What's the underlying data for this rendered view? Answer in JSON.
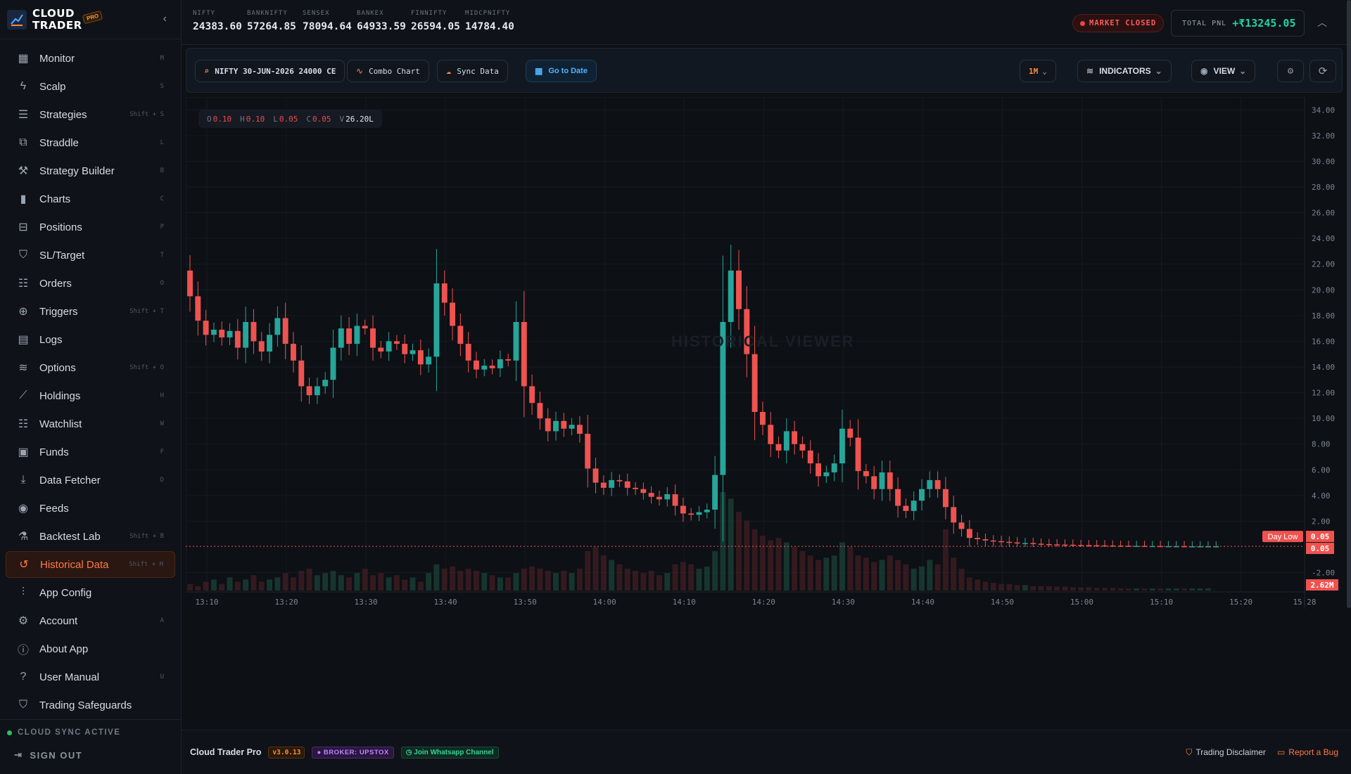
{
  "brand": {
    "name_line1": "CLOUD",
    "name_line2": "TRADER",
    "badge": "PRO"
  },
  "sidebar": {
    "items": [
      {
        "label": "Monitor",
        "shortcut": "M",
        "icon": "grid-icon"
      },
      {
        "label": "Scalp",
        "shortcut": "S",
        "icon": "bolt-icon"
      },
      {
        "label": "Strategies",
        "shortcut": "Shift + S",
        "icon": "layers-icon"
      },
      {
        "label": "Straddle",
        "shortcut": "L",
        "icon": "straddle-icon"
      },
      {
        "label": "Strategy Builder",
        "shortcut": "B",
        "icon": "wrench-icon"
      },
      {
        "label": "Charts",
        "shortcut": "C",
        "icon": "bar-chart-icon"
      },
      {
        "label": "Positions",
        "shortcut": "P",
        "icon": "briefcase-icon"
      },
      {
        "label": "SL/Target",
        "shortcut": "T",
        "icon": "shield-icon"
      },
      {
        "label": "Orders",
        "shortcut": "O",
        "icon": "list-icon"
      },
      {
        "label": "Triggers",
        "shortcut": "Shift + T",
        "icon": "target-icon"
      },
      {
        "label": "Logs",
        "shortcut": "",
        "icon": "document-icon"
      },
      {
        "label": "Options",
        "shortcut": "Shift + O",
        "icon": "stack-icon"
      },
      {
        "label": "Holdings",
        "shortcut": "H",
        "icon": "line-chart-icon"
      },
      {
        "label": "Watchlist",
        "shortcut": "W",
        "icon": "list-icon"
      },
      {
        "label": "Funds",
        "shortcut": "F",
        "icon": "wallet-icon"
      },
      {
        "label": "Data Fetcher",
        "shortcut": "D",
        "icon": "download-icon"
      },
      {
        "label": "Feeds",
        "shortcut": "",
        "icon": "broadcast-icon"
      },
      {
        "label": "Backtest Lab",
        "shortcut": "Shift + B",
        "icon": "flask-icon"
      },
      {
        "label": "Historical Data",
        "shortcut": "Shift + H",
        "icon": "history-icon",
        "active": true
      },
      {
        "label": "App Config",
        "shortcut": "",
        "icon": "sliders-icon"
      },
      {
        "label": "Account",
        "shortcut": "A",
        "icon": "gear-icon"
      },
      {
        "label": "About App",
        "shortcut": "",
        "icon": "info-icon"
      },
      {
        "label": "User Manual",
        "shortcut": "U",
        "icon": "help-icon"
      },
      {
        "label": "Trading Safeguards",
        "shortcut": "",
        "icon": "shield-icon"
      }
    ],
    "sync_status": "CLOUD SYNC ACTIVE",
    "sign_out": "SIGN OUT"
  },
  "ticker": [
    {
      "name": "NIFTY",
      "value": "24383.60"
    },
    {
      "name": "BANKNIFTY",
      "value": "57264.85"
    },
    {
      "name": "SENSEX",
      "value": "78094.64"
    },
    {
      "name": "BANKEX",
      "value": "64933.59"
    },
    {
      "name": "FINNIFTY",
      "value": "26594.05"
    },
    {
      "name": "MIDCPNIFTY",
      "value": "14784.40"
    }
  ],
  "market_status": "MARKET CLOSED",
  "pnl": {
    "label": "TOTAL PNL",
    "value": "+₹13245.05"
  },
  "toolbar": {
    "symbol": "NIFTY 30-JUN-2026 24000 CE",
    "combo": "Combo Chart",
    "sync": "Sync Data",
    "goto": "Go to Date",
    "timeframe": "1M",
    "indicators": "INDICATORS",
    "view": "VIEW"
  },
  "ohlc": {
    "o": "0.10",
    "h": "0.10",
    "l": "0.05",
    "c": "0.05",
    "v": "26.20L"
  },
  "watermark": "HISTORICAL VIEWER",
  "chart_data": {
    "type": "candlestick",
    "interval": "1M",
    "x_ticks": [
      "13:10",
      "13:20",
      "13:30",
      "13:40",
      "13:50",
      "14:00",
      "14:10",
      "14:20",
      "14:30",
      "14:40",
      "14:50",
      "15:00",
      "15:10",
      "15:20",
      "15:28"
    ],
    "y_ticks": [
      "34.00",
      "32.00",
      "30.00",
      "28.00",
      "26.00",
      "24.00",
      "22.00",
      "20.00",
      "18.00",
      "16.00",
      "14.00",
      "12.00",
      "10.00",
      "8.00",
      "6.00",
      "4.00",
      "2.00",
      "-2.00"
    ],
    "ylim": [
      -3.5,
      35
    ],
    "close_series": [
      19.5,
      17.6,
      16.5,
      16.9,
      16.3,
      16.8,
      15.5,
      17.5,
      16.0,
      15.2,
      16.5,
      17.8,
      15.8,
      14.5,
      12.5,
      11.8,
      12.5,
      13.0,
      15.5,
      17.0,
      15.8,
      17.2,
      17.0,
      15.5,
      15.2,
      16.0,
      15.8,
      15.0,
      15.3,
      14.2,
      14.8,
      20.5,
      19.0,
      17.2,
      15.8,
      14.5,
      13.8,
      14.1,
      13.9,
      14.6,
      14.5,
      17.5,
      12.5,
      11.2,
      10.0,
      9.0,
      9.8,
      9.2,
      9.5,
      8.8,
      6.1,
      5.0,
      4.6,
      5.2,
      5.1,
      4.6,
      4.5,
      4.2,
      3.9,
      3.7,
      4.1,
      3.2,
      2.6,
      2.5,
      2.7,
      2.9,
      5.6,
      17.5,
      21.5,
      18.5,
      15.0,
      10.5,
      9.5,
      8.0,
      7.5,
      9.0,
      8.0,
      7.5,
      6.5,
      5.5,
      5.8,
      6.5,
      9.2,
      8.5,
      5.9,
      5.5,
      4.5,
      5.8,
      4.5,
      3.2,
      2.8,
      3.6,
      4.5,
      5.2,
      4.5,
      3.1,
      1.9,
      1.4,
      0.7,
      0.6,
      0.5,
      0.45,
      0.4,
      0.35,
      0.3,
      0.3,
      0.25,
      0.22,
      0.2,
      0.18,
      0.17,
      0.15,
      0.14,
      0.13,
      0.12,
      0.11,
      0.1,
      0.09,
      0.08,
      0.08,
      0.07,
      0.07,
      0.06,
      0.06,
      0.06,
      0.05,
      0.05,
      0.05,
      0.05,
      0.05
    ],
    "volume_series": [
      0.3,
      0.2,
      0.4,
      0.5,
      0.3,
      0.6,
      0.4,
      0.5,
      0.7,
      0.4,
      0.5,
      0.6,
      0.8,
      0.6,
      0.9,
      1.0,
      0.7,
      0.8,
      0.9,
      0.7,
      0.6,
      0.8,
      1.0,
      0.7,
      0.8,
      0.6,
      0.7,
      0.5,
      0.6,
      0.4,
      0.8,
      1.2,
      1.0,
      1.1,
      0.9,
      1.0,
      0.9,
      0.8,
      0.7,
      0.6,
      0.6,
      0.8,
      1.0,
      1.1,
      1.0,
      0.9,
      0.8,
      0.9,
      0.8,
      1.0,
      1.8,
      2.0,
      1.6,
      1.4,
      1.2,
      1.0,
      0.9,
      0.8,
      0.9,
      0.7,
      0.8,
      1.2,
      1.3,
      1.2,
      1.0,
      1.1,
      1.8,
      4.5,
      4.2,
      3.6,
      3.2,
      2.8,
      2.5,
      2.3,
      2.4,
      2.2,
      2.0,
      1.8,
      1.6,
      1.4,
      1.5,
      1.6,
      2.2,
      2.0,
      1.6,
      1.5,
      1.3,
      1.4,
      1.6,
      1.4,
      1.2,
      1.0,
      1.1,
      1.4,
      1.2,
      2.8,
      1.5,
      1.0,
      0.6,
      0.5,
      0.4,
      0.35,
      0.3,
      0.3,
      0.25,
      0.25,
      0.2,
      0.2,
      0.2,
      0.18,
      0.18,
      0.15,
      0.15,
      0.15,
      0.12,
      0.12,
      0.12,
      0.1,
      0.1,
      0.1,
      0.1,
      0.1,
      0.1,
      0.1,
      0.1,
      0.1,
      0.1,
      0.1,
      0.1
    ],
    "labels": {
      "day_low": "Day Low",
      "last_price": "0.05",
      "day_low_price": "0.05",
      "last_volume": "2.62M"
    },
    "colors": {
      "up": "#26a69a",
      "down": "#ef5350"
    }
  },
  "footer": {
    "app_name": "Cloud Trader Pro",
    "version": "v3.0.13",
    "broker": "BROKER: UPSTOX",
    "whatsapp": "Join Whatsapp Channel",
    "disclaimer": "Trading Disclaimer",
    "report_bug": "Report a Bug"
  }
}
